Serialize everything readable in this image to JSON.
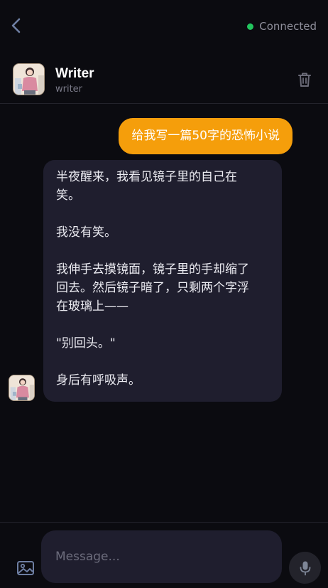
{
  "status": {
    "label": "Connected",
    "color": "#22c55e"
  },
  "character": {
    "name": "Writer",
    "handle": "writer"
  },
  "input": {
    "placeholder": "Message..."
  },
  "messages": {
    "user": "给我写一篇50字的恐怖小说",
    "bot": {
      "line1": "半夜醒来，我看见镜子里的自己在",
      "line2": "笑。",
      "line3": "我没有笑。",
      "line4": "我伸手去摸镜面，镜子里的手却缩了",
      "line5": "回去。然后镜子暗了，只剩两个字浮",
      "line6": "在玻璃上——",
      "line7": "\"别回头。\"",
      "line8": "身后有呼吸声。"
    }
  },
  "icons": {
    "back": "chevron-left-icon",
    "delete": "trash-icon",
    "image": "image-icon",
    "mic": "microphone-icon"
  },
  "colors": {
    "accent": "#f59e0b",
    "bubble": "#1f1e2e",
    "background": "#0b0b10"
  }
}
